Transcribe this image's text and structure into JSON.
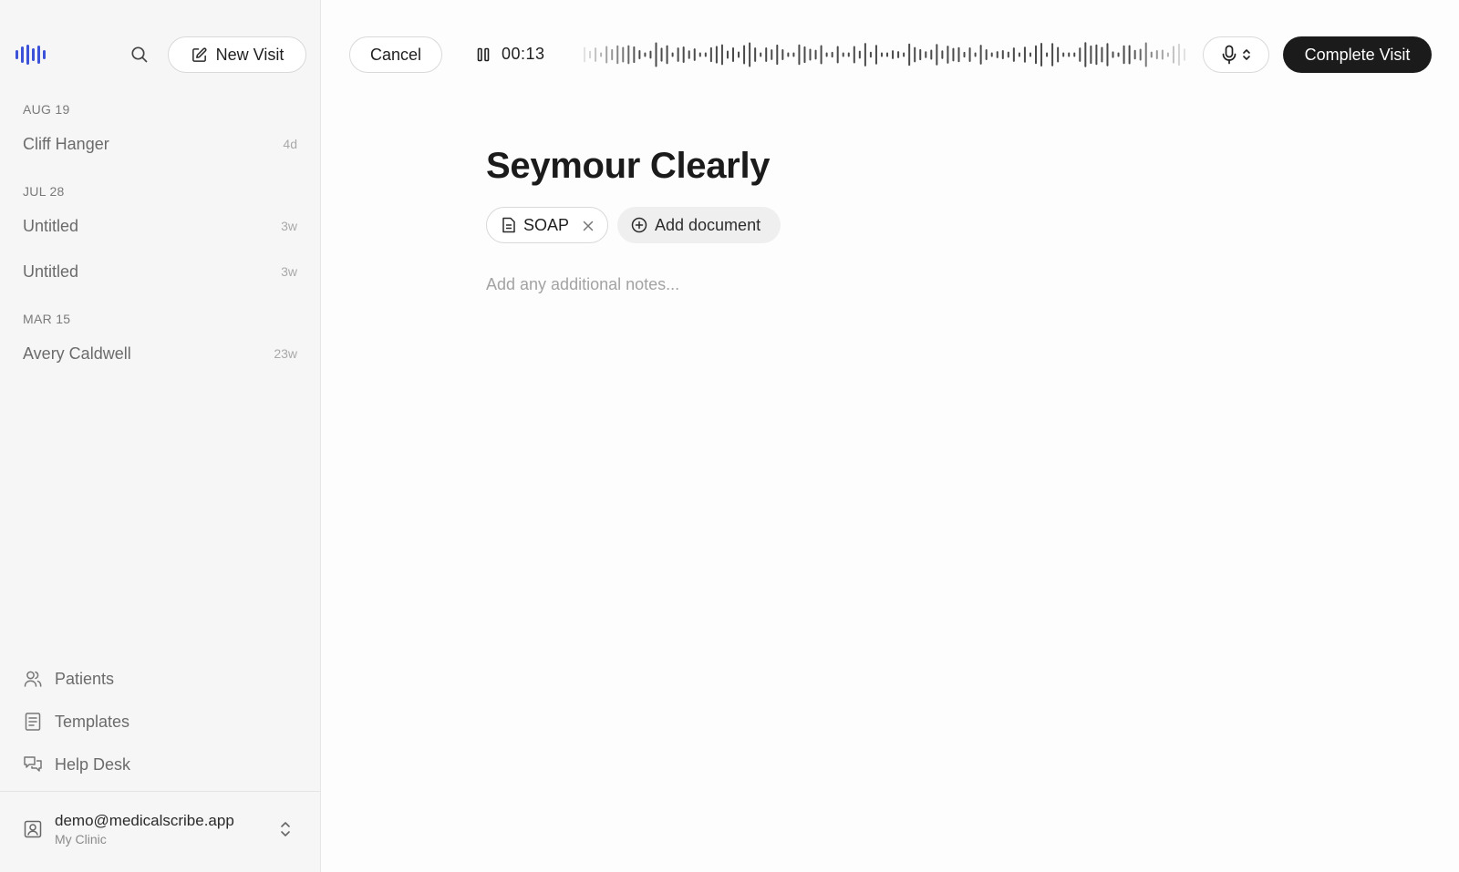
{
  "sidebar": {
    "new_visit_label": "New Visit",
    "groups": [
      {
        "date": "AUG 19",
        "visits": [
          {
            "name": "Cliff Hanger",
            "age": "4d"
          }
        ]
      },
      {
        "date": "JUL 28",
        "visits": [
          {
            "name": "Untitled",
            "age": "3w"
          },
          {
            "name": "Untitled",
            "age": "3w"
          }
        ]
      },
      {
        "date": "MAR 15",
        "visits": [
          {
            "name": "Avery Caldwell",
            "age": "23w"
          }
        ]
      }
    ],
    "nav": [
      {
        "label": "Patients",
        "icon": "users-icon"
      },
      {
        "label": "Templates",
        "icon": "document-list-icon"
      },
      {
        "label": "Help Desk",
        "icon": "chat-bubbles-icon"
      }
    ],
    "account": {
      "email": "demo@medicalscribe.app",
      "clinic": "My Clinic"
    }
  },
  "topbar": {
    "cancel_label": "Cancel",
    "timer": "00:13",
    "complete_label": "Complete Visit"
  },
  "main": {
    "patient_name": "Seymour Clearly",
    "documents": [
      {
        "label": "SOAP"
      }
    ],
    "add_document_label": "Add document",
    "notes_placeholder": "Add any additional notes..."
  },
  "colors": {
    "brand": "#3b52d9",
    "primary_button": "#1b1b1b",
    "sidebar_bg": "#f6f6f6"
  }
}
